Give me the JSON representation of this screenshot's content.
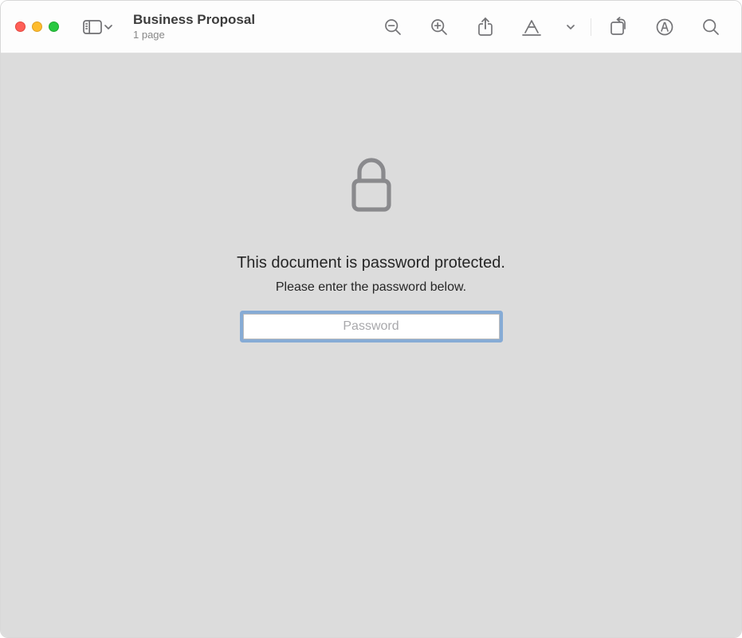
{
  "doc": {
    "title": "Business Proposal",
    "subtitle": "1 page"
  },
  "content": {
    "heading": "This document is password protected.",
    "subtext": "Please enter the password below.",
    "password_placeholder": "Password"
  }
}
